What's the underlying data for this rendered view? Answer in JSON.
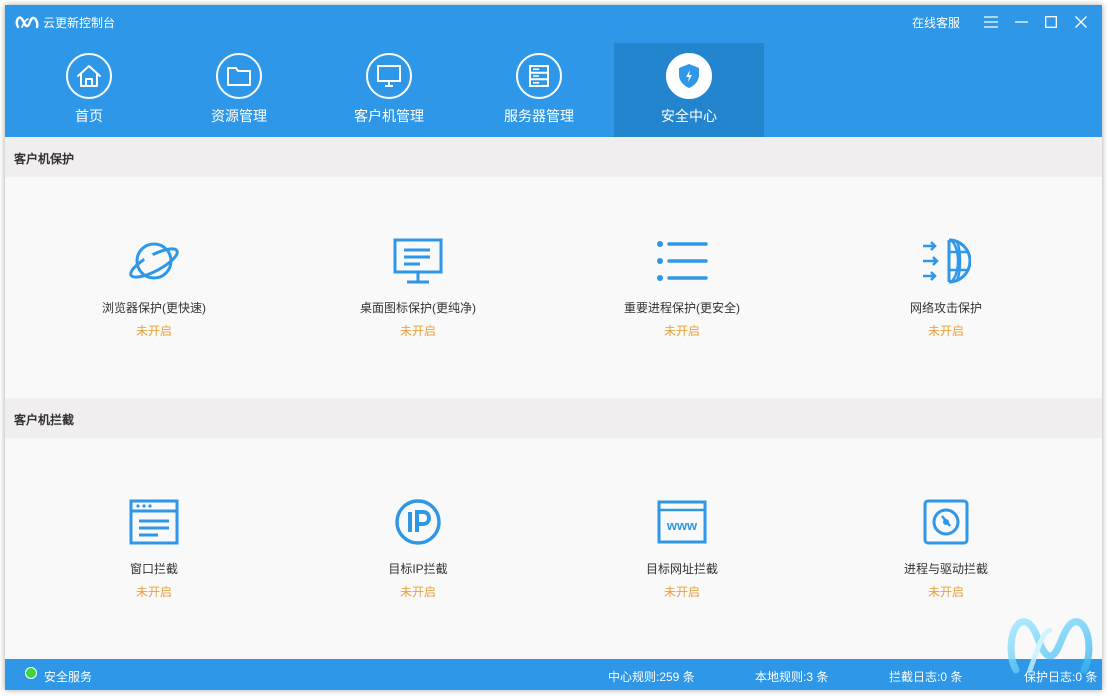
{
  "app": {
    "title": "云更新控制台",
    "online_service": "在线客服"
  },
  "nav": {
    "tabs": [
      {
        "label": "首页",
        "icon": "home-icon"
      },
      {
        "label": "资源管理",
        "icon": "folder-icon"
      },
      {
        "label": "客户机管理",
        "icon": "monitor-icon"
      },
      {
        "label": "服务器管理",
        "icon": "server-icon"
      },
      {
        "label": "安全中心",
        "icon": "shield-icon"
      }
    ],
    "active": 4
  },
  "sections": [
    {
      "title": "客户机保护",
      "items": [
        {
          "label": "浏览器保护(更快速)",
          "status": "未开启",
          "icon": "browser-planet-icon"
        },
        {
          "label": "桌面图标保护(更纯净)",
          "status": "未开启",
          "icon": "desktop-monitor-icon"
        },
        {
          "label": "重要进程保护(更安全)",
          "status": "未开启",
          "icon": "process-list-icon"
        },
        {
          "label": "网络攻击保护",
          "status": "未开启",
          "icon": "network-shield-icon"
        }
      ]
    },
    {
      "title": "客户机拦截",
      "items": [
        {
          "label": "窗口拦截",
          "status": "未开启",
          "icon": "window-icon"
        },
        {
          "label": "目标IP拦截",
          "status": "未开启",
          "icon": "ip-icon"
        },
        {
          "label": "目标网址拦截",
          "status": "未开启",
          "icon": "www-icon"
        },
        {
          "label": "进程与驱动拦截",
          "status": "未开启",
          "icon": "driver-disk-icon"
        }
      ]
    }
  ],
  "statusbar": {
    "service": "安全服务",
    "center_rules": "中心规则:259 条",
    "local_rules": "本地规则:3 条",
    "block_log": "拦截日志:0 条",
    "protect_log": "保护日志:0 条"
  },
  "colors": {
    "primary": "#2e97e7",
    "active_tab": "#2485cf",
    "icon_blue": "#2e97e7",
    "status_off": "#e6a23c",
    "online_dot": "#3fd33f"
  }
}
